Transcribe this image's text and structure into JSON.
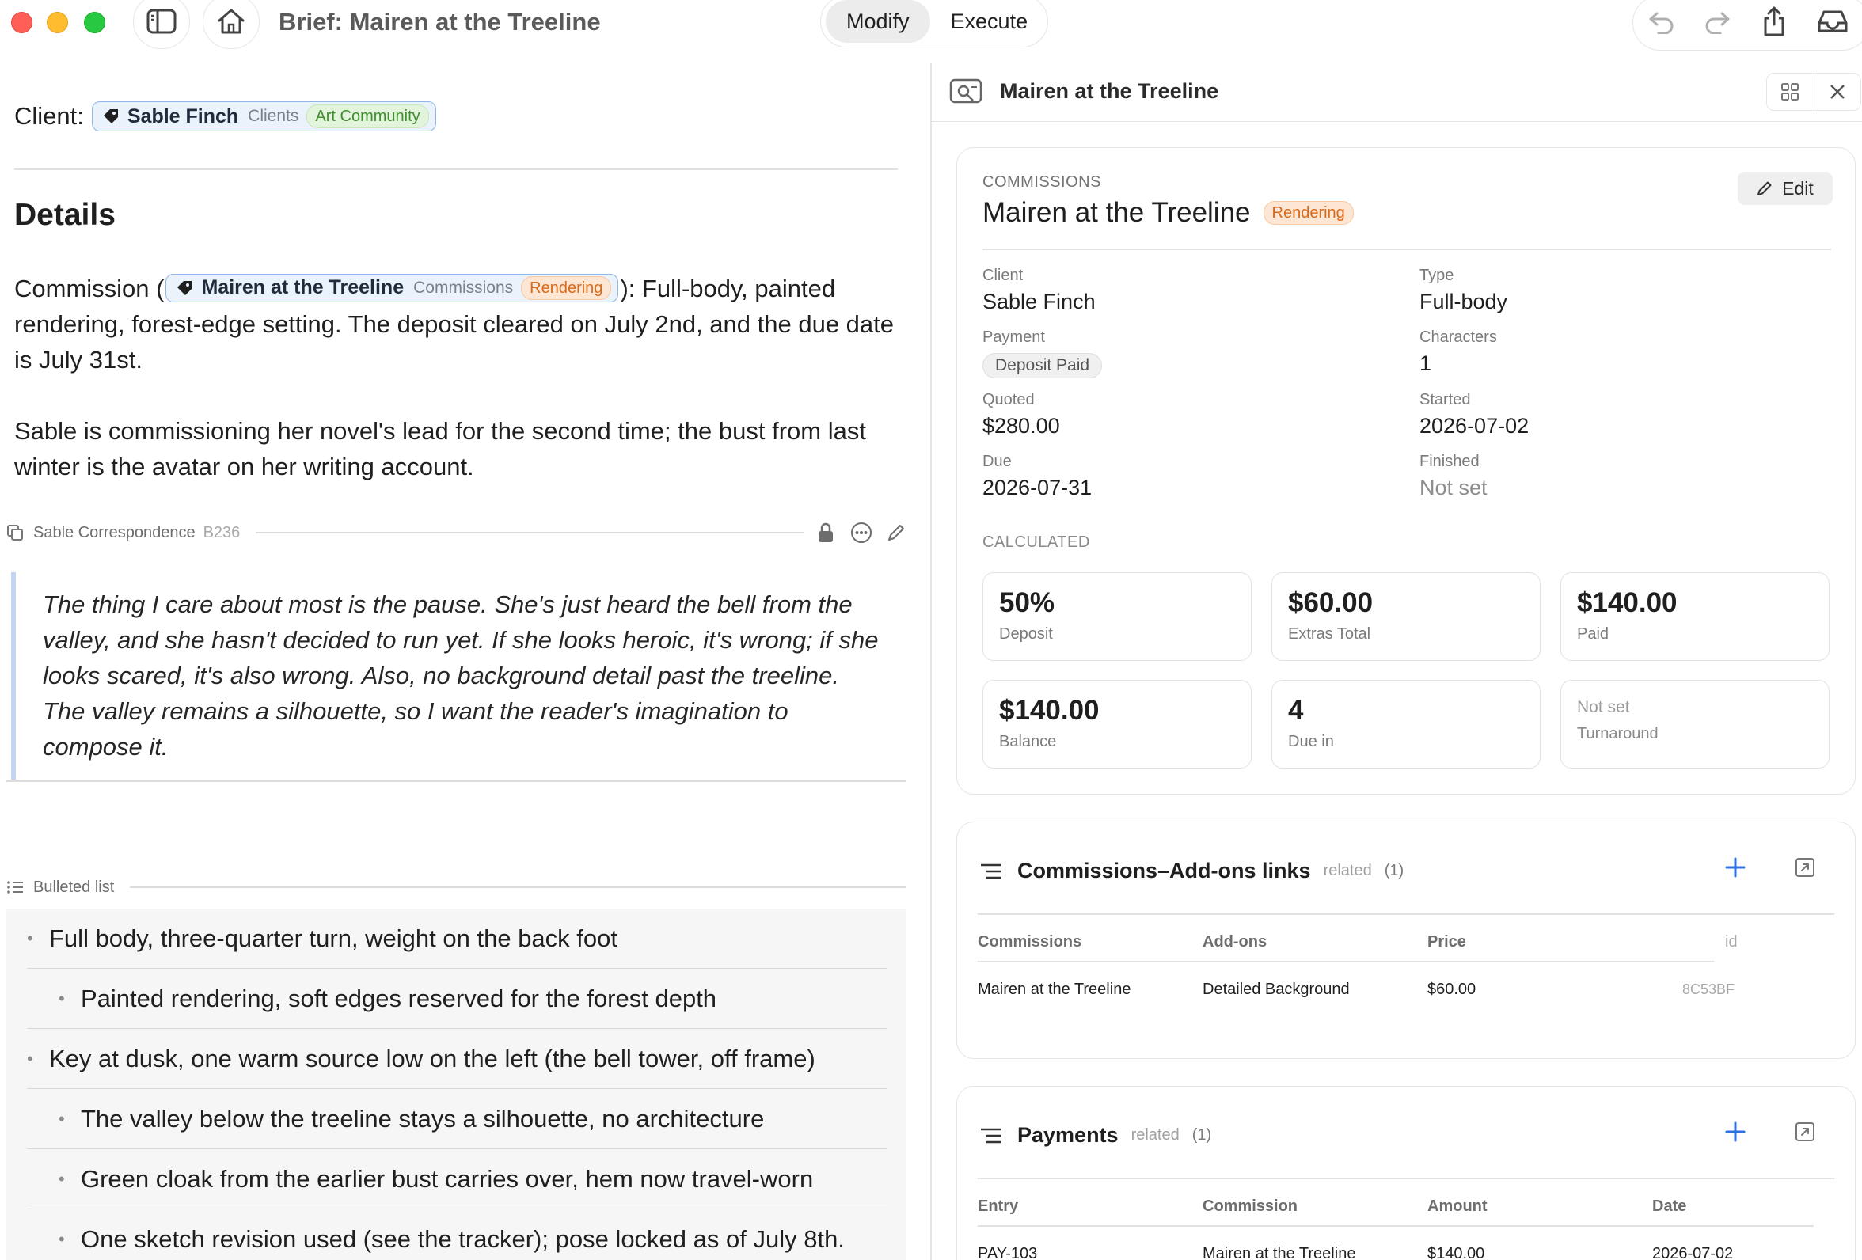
{
  "window": {
    "title": "Brief: Mairen at the Treeline",
    "modes": [
      "Modify",
      "Execute"
    ],
    "active_mode": "Modify"
  },
  "left": {
    "client_label": "Client:",
    "client_chip": {
      "name": "Sable Finch",
      "database": "Clients",
      "tag": "Art Community"
    },
    "details_heading": "Details",
    "commission_prefix": "Commission (",
    "commission_chip": {
      "name": "Mairen at the Treeline",
      "database": "Commissions",
      "status": "Rendering"
    },
    "commission_suffix": "): Full-body, painted rendering, forest-edge setting. The deposit cleared on July 2nd, and the due date is July 31st.",
    "paragraph2": "Sable is commissioning her novel's lead for the second time; the bust from last winter is the avatar on her writing account.",
    "quote_block": {
      "title": "Sable Correspondence",
      "code": "B236",
      "text": "The thing I care about most is the pause. She's just heard the bell from the valley, and she hasn't decided to run yet. If she looks heroic, it's wrong; if she looks scared, it's also wrong. Also, no background detail past the treeline. The valley remains a silhouette, so I want the reader's imagination to compose it."
    },
    "list_block": {
      "title": "Bulleted list",
      "items": [
        {
          "level": 1,
          "text": "Full body, three-quarter turn, weight on the back foot"
        },
        {
          "level": 2,
          "text": "Painted rendering, soft edges reserved for the forest depth"
        },
        {
          "level": 1,
          "text": "Key at dusk, one warm source low on the left (the bell tower, off frame)"
        },
        {
          "level": 2,
          "text": "The valley below the treeline stays a silhouette, no architecture"
        },
        {
          "level": 2,
          "text": "Green cloak from the earlier bust carries over, hem now travel-worn"
        },
        {
          "level": 2,
          "text": "One sketch revision used (see the tracker); pose locked as of July 8th."
        }
      ]
    }
  },
  "right": {
    "header_title": "Mairen at the Treeline",
    "record": {
      "collection": "COMMISSIONS",
      "title": "Mairen at the Treeline",
      "status": "Rendering",
      "edit_label": "Edit",
      "fields": {
        "client": {
          "label": "Client",
          "value": "Sable Finch"
        },
        "type": {
          "label": "Type",
          "value": "Full-body"
        },
        "payment": {
          "label": "Payment",
          "value": "Deposit Paid"
        },
        "characters": {
          "label": "Characters",
          "value": "1"
        },
        "quoted": {
          "label": "Quoted",
          "value": "$280.00"
        },
        "started": {
          "label": "Started",
          "value": "2026-07-02"
        },
        "due": {
          "label": "Due",
          "value": "2026-07-31"
        },
        "finished": {
          "label": "Finished",
          "value": "Not set"
        }
      },
      "calculated_label": "CALCULATED",
      "stats": [
        {
          "value": "50%",
          "label": "Deposit"
        },
        {
          "value": "$60.00",
          "label": "Extras Total"
        },
        {
          "value": "$140.00",
          "label": "Paid"
        },
        {
          "value": "$140.00",
          "label": "Balance"
        },
        {
          "value": "4",
          "label": "Due in"
        },
        {
          "value": "Not set",
          "label": "Turnaround"
        }
      ]
    },
    "addons": {
      "title": "Commissions–Add-ons links",
      "related": "related",
      "count": "(1)",
      "columns": [
        "Commissions",
        "Add-ons",
        "Price",
        "id"
      ],
      "rows": [
        {
          "commissions": "Mairen at the Treeline",
          "addons": "Detailed Background",
          "price": "$60.00",
          "id": "8C53BF"
        }
      ]
    },
    "payments": {
      "title": "Payments",
      "related": "related",
      "count": "(1)",
      "columns": [
        "Entry",
        "Commission",
        "Amount",
        "Date"
      ],
      "rows": [
        {
          "entry": "PAY-103",
          "commission": "Mairen at the Treeline",
          "amount": "$140.00",
          "date": "2026-07-02"
        }
      ]
    }
  }
}
